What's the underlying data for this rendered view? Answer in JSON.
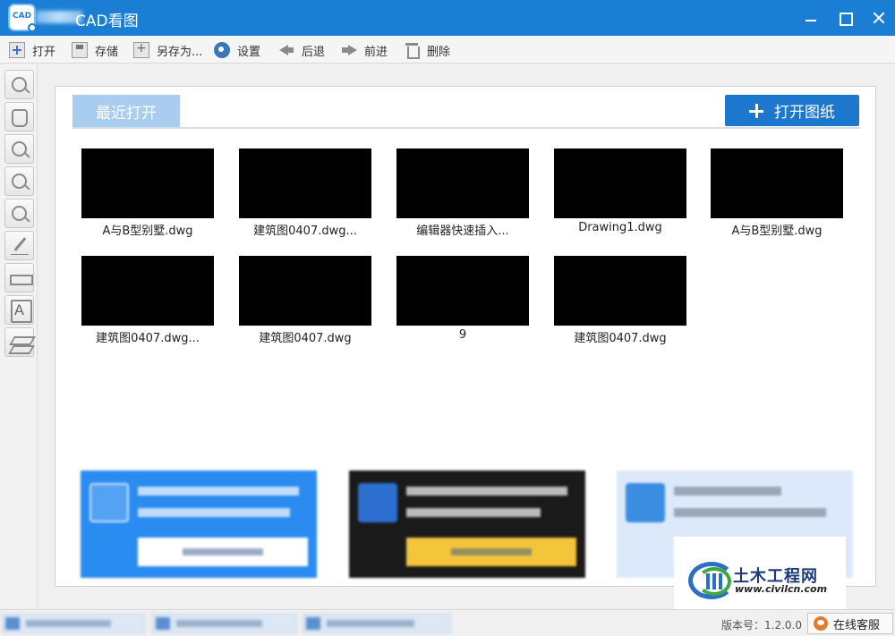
{
  "window": {
    "title": "CAD看图"
  },
  "toolbar": {
    "items": [
      {
        "label": "打开",
        "icon": "plus-icon"
      },
      {
        "label": "存储",
        "icon": "save-icon"
      },
      {
        "label": "另存为...",
        "icon": "save-as-icon"
      },
      {
        "label": "设置",
        "icon": "gear-icon"
      },
      {
        "label": "后退",
        "icon": "back-arrow-icon"
      },
      {
        "label": "前进",
        "icon": "forward-arrow-icon"
      },
      {
        "label": "删除",
        "icon": "trash-icon"
      }
    ]
  },
  "palette": {
    "tools": [
      "zoom-previous-icon",
      "pan-hand-icon",
      "zoom-window-icon",
      "zoom-in-icon",
      "zoom-out-icon",
      "measure-pen-icon",
      "ruler-icon",
      "text-icon",
      "layers-icon"
    ]
  },
  "recent": {
    "tab_label": "最近打开",
    "open_button_label": "打开图纸",
    "files": [
      {
        "name": "A与B型别墅.dwg"
      },
      {
        "name": "建筑图0407.dwg..."
      },
      {
        "name": "编辑器快速插入..."
      },
      {
        "name": "Drawing1.dwg"
      },
      {
        "name": "A与B型别墅.dwg"
      },
      {
        "name": "建筑图0407.dwg..."
      },
      {
        "name": "建筑图0407.dwg"
      },
      {
        "name": "9"
      },
      {
        "name": "建筑图0407.dwg"
      }
    ]
  },
  "watermark": {
    "title": "土木工程网",
    "url": "www.civilcn.com"
  },
  "statusbar": {
    "version": "版本号：1.2.0.0",
    "service_label": "在线客服"
  },
  "colors": {
    "title_bar": "#1a7fd4",
    "accent": "#1d77cd",
    "tab_inactive": "#a8cdee"
  }
}
